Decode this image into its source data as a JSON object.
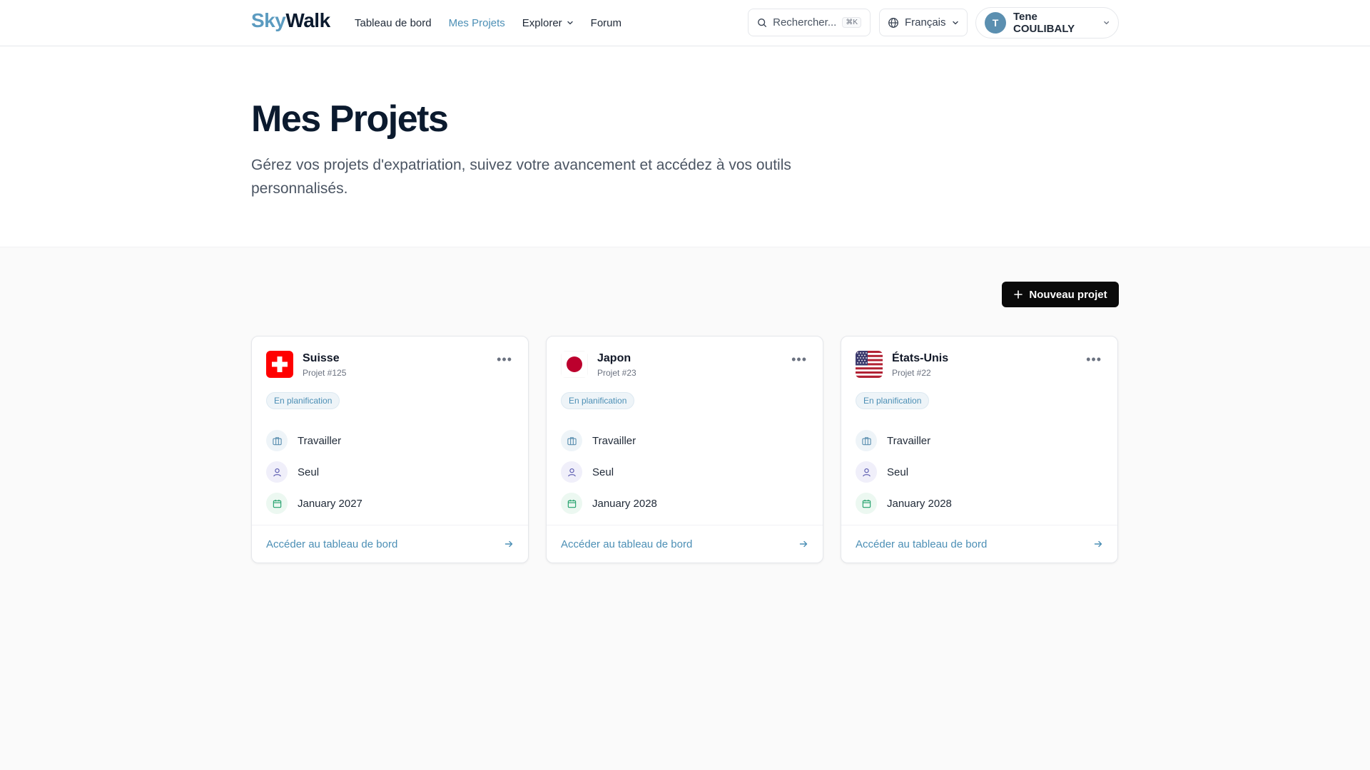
{
  "app": {
    "logo_part1": "Sky",
    "logo_part2": "Walk"
  },
  "nav": {
    "items": [
      {
        "label": "Tableau de bord"
      },
      {
        "label": "Mes Projets"
      },
      {
        "label": "Explorer"
      },
      {
        "label": "Forum"
      }
    ]
  },
  "search": {
    "placeholder": "Rechercher...",
    "shortcut": "⌘K"
  },
  "language": {
    "selected": "Français"
  },
  "user": {
    "initial": "T",
    "name": "Tene COULIBALY"
  },
  "hero": {
    "title": "Mes Projets",
    "subtitle": "Gérez vos projets d'expatriation, suivez votre avancement et accédez à vos outils personnalisés."
  },
  "actions": {
    "new_project": "Nouveau projet"
  },
  "projects": [
    {
      "country": "Suisse",
      "id_label": "Projet #125",
      "status": "En planification",
      "purpose": "Travailler",
      "household": "Seul",
      "date": "January 2027",
      "link": "Accéder au tableau de bord"
    },
    {
      "country": "Japon",
      "id_label": "Projet #23",
      "status": "En planification",
      "purpose": "Travailler",
      "household": "Seul",
      "date": "January 2028",
      "link": "Accéder au tableau de bord"
    },
    {
      "country": "États-Unis",
      "id_label": "Projet #22",
      "status": "En planification",
      "purpose": "Travailler",
      "household": "Seul",
      "date": "January 2028",
      "link": "Accéder au tableau de bord"
    }
  ],
  "colors": {
    "accent": "#4c8fb5",
    "brand_dark": "#0b1a2e",
    "primary_button": "#0a0a0a"
  },
  "icons": {
    "search": "search-icon",
    "language": "globe-icon",
    "dropdown": "chevron-down-icon",
    "more": "more-horizontal-icon",
    "purpose": "briefcase-icon",
    "household": "user-icon",
    "date": "calendar-icon",
    "link": "arrow-right-icon",
    "add": "plus-icon"
  }
}
